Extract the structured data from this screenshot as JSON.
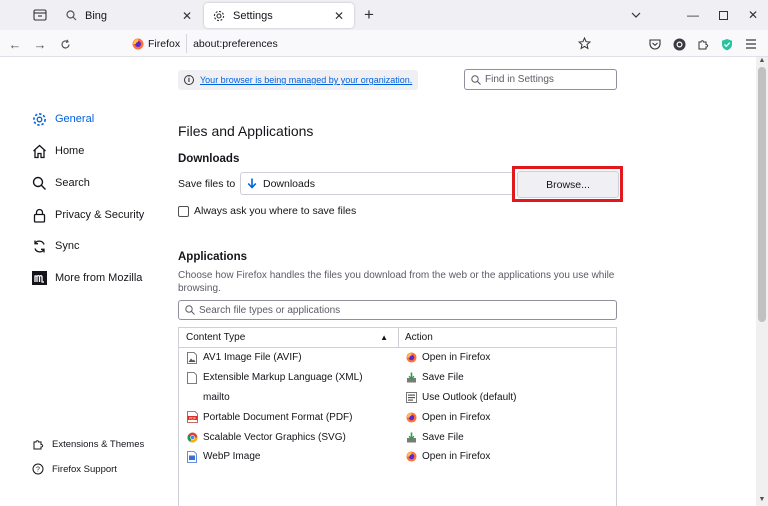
{
  "tabs": [
    {
      "title": "Bing",
      "active": false
    },
    {
      "title": "Settings",
      "active": true
    }
  ],
  "navbar": {
    "identity_label": "Firefox",
    "url": "about:preferences"
  },
  "sidebar": {
    "items": [
      {
        "label": "General",
        "icon": "gear-icon",
        "selected": true
      },
      {
        "label": "Home",
        "icon": "home-icon"
      },
      {
        "label": "Search",
        "icon": "search-icon"
      },
      {
        "label": "Privacy & Security",
        "icon": "lock-icon"
      },
      {
        "label": "Sync",
        "icon": "sync-icon"
      },
      {
        "label": "More from Mozilla",
        "icon": "mozilla-icon"
      }
    ],
    "footer": [
      {
        "label": "Extensions & Themes",
        "icon": "puzzle-icon"
      },
      {
        "label": "Firefox Support",
        "icon": "help-icon"
      }
    ]
  },
  "policies_link": "Your browser is being managed by your organization.",
  "find_placeholder": "Find in Settings",
  "files_apps": {
    "title": "Files and Applications",
    "downloads_heading": "Downloads",
    "save_files_label": "Save files to",
    "save_files_value": "Downloads",
    "browse_label": "Browse...",
    "always_ask_label": "Always ask you where to save files",
    "always_ask_checked": false
  },
  "applications": {
    "heading": "Applications",
    "description": "Choose how Firefox handles the files you download from the web or the applications you use while browsing.",
    "search_placeholder": "Search file types or applications",
    "columns": {
      "type": "Content Type",
      "action": "Action"
    },
    "rows": [
      {
        "type": "AV1 Image File (AVIF)",
        "type_icon": "image-file-icon",
        "action": "Open in Firefox",
        "action_icon": "firefox-icon"
      },
      {
        "type": "Extensible Markup Language (XML)",
        "type_icon": "document-icon",
        "action": "Save File",
        "action_icon": "save-file-icon"
      },
      {
        "type": "mailto",
        "type_icon": "none",
        "action": "Use Outlook (default)",
        "action_icon": "outlook-icon"
      },
      {
        "type": "Portable Document Format (PDF)",
        "type_icon": "pdf-icon",
        "action": "Open in Firefox",
        "action_icon": "firefox-icon"
      },
      {
        "type": "Scalable Vector Graphics (SVG)",
        "type_icon": "chrome-icon",
        "action": "Save File",
        "action_icon": "save-file-icon"
      },
      {
        "type": "WebP Image",
        "type_icon": "webp-icon",
        "action": "Open in Firefox",
        "action_icon": "firefox-icon"
      }
    ]
  },
  "colors": {
    "accent": "#0061e0",
    "highlight": "#e1191f"
  }
}
